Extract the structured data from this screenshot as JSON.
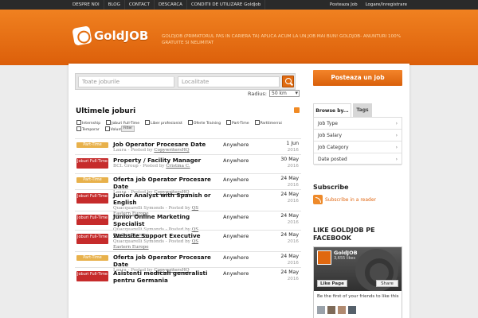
{
  "topbar": {
    "nav": [
      "DESPRE NOI",
      "BLOG",
      "CONTACT",
      "DESCARCA",
      "CONDITII DE UTILIZARE GoldJob"
    ],
    "right": [
      "Posteaza Job",
      "Logare/Inregistrare"
    ]
  },
  "header": {
    "logo_text": "GoldJOB",
    "tagline": "GOLDJOB (PRIMATORUL PAS IN CARIERA TA) APLICA ACUM LA UN JOB MAI BUN! GOLDJOB- ANUNTURI 100% GRATUITE SI NELIMITAT"
  },
  "search": {
    "job_placeholder": "Toate joburile",
    "location_placeholder": "Localitate",
    "radius_label": "Radius:",
    "radius_value": "50 km"
  },
  "section_title": "Ultimele joburi",
  "filters": [
    "Internship",
    "Joburi Full-Time",
    "Liber profesionist",
    "Oferte Training",
    "Part-Time",
    "Parttimerrai",
    "Temporar",
    "Voluntar"
  ],
  "filter_button": "Filter",
  "jobs": [
    {
      "type": "Part-Time",
      "kind": "pt",
      "title": "Job Operator Procesare Date",
      "meta": "Laura - Posted by ",
      "poster": "CopywritersHQ",
      "location": "Anywhere",
      "date": "1 Jun",
      "year": "2016"
    },
    {
      "type": "Joburi Full-Time",
      "kind": "ft",
      "title": "Property / Facility Manager",
      "meta": "BCL Group - Posted by ",
      "poster": "Cristina C.",
      "location": "Anywhere",
      "date": "30 May",
      "year": "2016"
    },
    {
      "type": "Part-Time",
      "kind": "pt",
      "title": "Oferta job Operator Procesare Date",
      "meta": "Laura - Posted by ",
      "poster": "CopywritersHQ",
      "location": "Anywhere",
      "date": "24 May",
      "year": "2016"
    },
    {
      "type": "Joburi Full-Time",
      "kind": "ft",
      "title": "Junior Analyst with Spanish or English",
      "meta": "Quacquarelli Symonds - Posted by ",
      "poster": "QS Eastern Europe",
      "location": "Anywhere",
      "date": "24 May",
      "year": "2016"
    },
    {
      "type": "Joburi Full-Time",
      "kind": "ft",
      "title": "Junior Online Marketing Specialist",
      "meta": "Quacquarelli Symonds - Posted by ",
      "poster": "QS Eastern Europe",
      "location": "Anywhere",
      "date": "24 May",
      "year": "2016"
    },
    {
      "type": "Joburi Full-Time",
      "kind": "ft",
      "title": "Website Support Executive",
      "meta": "Quacquarelli Symonds - Posted by ",
      "poster": "QS Eastern Europe",
      "location": "Anywhere",
      "date": "24 May",
      "year": "2016"
    },
    {
      "type": "Part-Time",
      "kind": "pt",
      "title": "Oferta job Operator Procesare Date",
      "meta": "Laura - Posted by ",
      "poster": "CopywritersHQ",
      "location": "Anywhere",
      "date": "24 May",
      "year": "2016"
    },
    {
      "type": "Joburi Full-Time",
      "kind": "ft",
      "title": "Asistenti medicali generalisti pentru Germania",
      "meta": "",
      "poster": "",
      "location": "Anywhere",
      "date": "24 May",
      "year": "2016"
    }
  ],
  "sidebar": {
    "post_button": "Posteaza un job",
    "tabs": [
      "Browse by...",
      "Tags"
    ],
    "browse_items": [
      "Job Type",
      "Job Salary",
      "Job Category",
      "Date posted"
    ],
    "subscribe_title": "Subscribe",
    "subscribe_link": "Subscribe in a reader",
    "like_title": "LIKE GOLDJOB PE FACEBOOK",
    "fb_name": "GoldJOB",
    "fb_likes": "3,655 likes",
    "fb_like_button": "Like Page",
    "fb_share_button": "Share",
    "fb_first": "Be the first of your friends to like this"
  },
  "colors": {
    "accent": "#e06b10",
    "part_time": "#e8b14b",
    "full_time": "#c62b2b"
  }
}
